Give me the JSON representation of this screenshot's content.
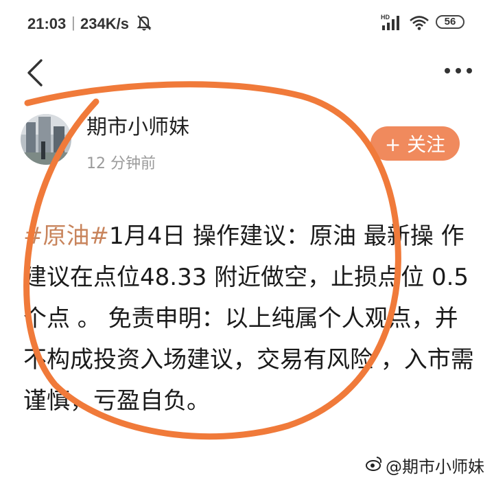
{
  "status_bar": {
    "time": "21:03",
    "separator": "|",
    "net_speed": "234K/s",
    "hd_label": "HD",
    "battery": "56",
    "icons": [
      "mute-bell-icon",
      "signal-icon",
      "wifi-icon",
      "battery-icon"
    ]
  },
  "toolbar": {
    "back_icon": "chevron-left-icon",
    "more_icon": "more-horizontal-icon"
  },
  "author": {
    "name": "期市小师妹",
    "time_ago": "12 分钟前",
    "follow_label": "+ 关注"
  },
  "post": {
    "hashtag": "#原油#",
    "text": "1月4日 操作建议：原油 最新操 作建议在点位48.33 附近做空，止损点位 0.5 个点 。 免责申明：以上纯属个人观点，并不构成投资入场建议，交易有风险 ，入市需谨慎，亏盈自负。"
  },
  "watermark": {
    "text": "@期市小师妹"
  },
  "colors": {
    "accent": "#f08a5d",
    "hashtag": "#c8845c",
    "annotation": "#f07a3a",
    "muted_text": "#9a9a9a"
  }
}
